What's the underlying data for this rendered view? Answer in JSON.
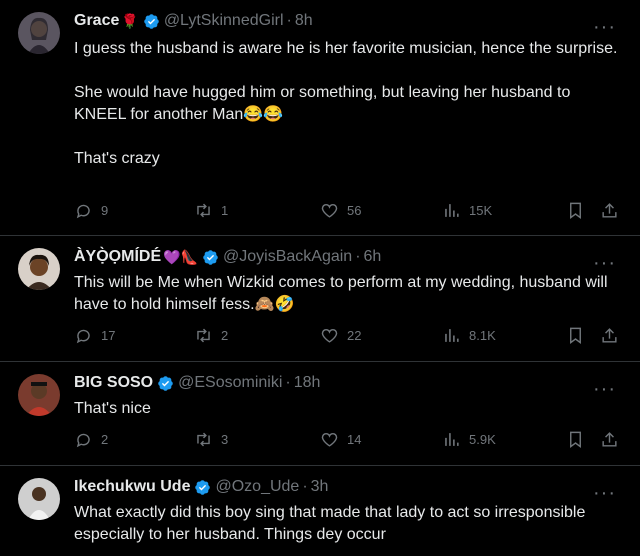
{
  "tweets": [
    {
      "name": "Grace",
      "name_emoji": "🌹",
      "handle": "@LytSkinnedGirl",
      "time": "8h",
      "paragraphs": [
        "I guess the husband is aware he is her favorite musician, hence the surprise.",
        "She would have hugged him or something, but leaving her husband to KNEEL for another Man😂😂",
        "That's crazy"
      ],
      "replies": "9",
      "retweets": "1",
      "likes": "56",
      "views": "15K"
    },
    {
      "name": "ÀYỌ̀ỌMÍDÉ",
      "name_emoji": "💜👠",
      "handle": "@JoyisBackAgain",
      "time": "6h",
      "paragraphs": [
        "This will be Me  when Wizkid comes to perform at my wedding, husband will have to hold himself fess.🙈🤣"
      ],
      "replies": "17",
      "retweets": "2",
      "likes": "22",
      "views": "8.1K"
    },
    {
      "name": "BIG SOSO",
      "name_emoji": "",
      "handle": "@ESosominiki",
      "time": "18h",
      "paragraphs": [
        "That's nice"
      ],
      "replies": "2",
      "retweets": "3",
      "likes": "14",
      "views": "5.9K"
    },
    {
      "name": "Ikechukwu Ude",
      "name_emoji": "",
      "handle": "@Ozo_Ude",
      "time": "3h",
      "paragraphs": [
        "What exactly did this boy sing that made that lady to act so irresponsible especially to her husband. Things dey occur"
      ]
    }
  ],
  "ui": {
    "separator": "·",
    "more": "···",
    "verified_color": "#1d9bf0"
  },
  "icons": [
    "reply-icon",
    "retweet-icon",
    "like-icon",
    "views-icon",
    "bookmark-icon",
    "share-icon",
    "verified-badge-icon",
    "more-icon"
  ]
}
